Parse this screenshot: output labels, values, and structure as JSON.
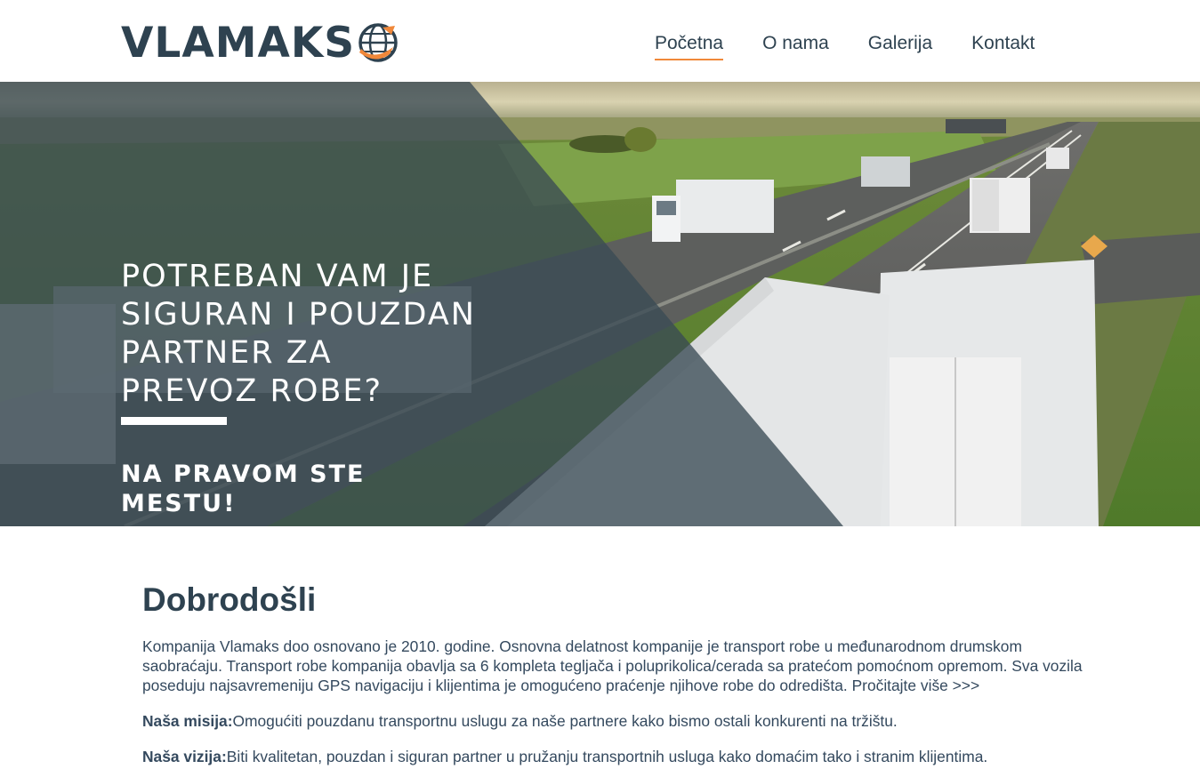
{
  "header": {
    "logo_text": "VLAMAKS",
    "nav": [
      {
        "label": "Početna",
        "active": true
      },
      {
        "label": "O nama",
        "active": false
      },
      {
        "label": "Galerija",
        "active": false
      },
      {
        "label": "Kontakt",
        "active": false
      }
    ]
  },
  "hero": {
    "headline": "Potreban vam je siguran i pouzdan partner za prevoz robe?",
    "subheadline": "Na pravom ste mestu!"
  },
  "main": {
    "title": "Dobrodošli",
    "intro": "Kompanija Vlamaks doo osnovano je 2010. godine. Osnovna delatnost kompanije je transport robe u međunarodnom drumskom saobraćaju. Transport robe kompanija obavlja sa 6 kompleta tegljača i poluprikolica/cerada sa pratećom pomoćnom opremom. Sva vozila poseduju najsavremeniju GPS navigaciju i klijentima je omogućeno praćenje njihove robe do odredišta.",
    "read_more": "Pročitajte više >>>",
    "mission_label": "Naša misija:",
    "mission_text": "Omogućiti pouzdanu transportnu uslugu za naše partnere kako bismo ostali konkurenti na tržištu.",
    "vision_label": "Naša vizija:",
    "vision_text": "Biti kvalitetan, pouzdan i siguran partner u pružanju transportnih usluga kako domaćim tako i stranim klijentima."
  },
  "colors": {
    "brand_dark": "#2e4250",
    "accent_orange": "#f0883a",
    "overlay": "#3a4a55"
  },
  "icons": [
    "globe-logo-icon"
  ]
}
